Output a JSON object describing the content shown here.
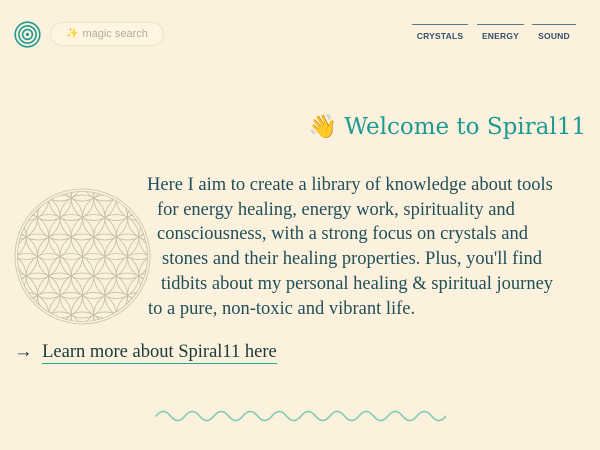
{
  "header": {
    "logo_icon": "spiral-logo-icon",
    "search": {
      "icon": "sparkles-icon",
      "icon_glyph": "✨",
      "placeholder": "magic search"
    },
    "nav": [
      {
        "label": "CRYSTALS"
      },
      {
        "label": "ENERGY"
      },
      {
        "label": "SOUND"
      }
    ]
  },
  "main": {
    "welcome": {
      "emoji": "👋",
      "text": "Welcome to Spiral11"
    },
    "decor_icon": "flower-of-life-icon",
    "intro_lines": [
      "Here I aim to create a library of knowledge about tools",
      "for energy healing, energy work, spirituality and",
      "consciousness, with a strong focus on crystals and",
      "stones and their healing properties. Plus, you'll find",
      "tidbits about my personal healing & spiritual journey",
      "to a pure, non-toxic and vibrant life."
    ],
    "more_link": {
      "arrow": "→",
      "text": "Learn more about Spiral11 here"
    },
    "divider_icon": "squiggle-divider-icon"
  },
  "colors": {
    "background": "#fcf1dd",
    "accent": "#1e9a93",
    "text": "#1f4f5a",
    "nav_text": "#33506c",
    "flower_stroke": "#c8bea8",
    "squiggle": "#7ccbb0"
  }
}
